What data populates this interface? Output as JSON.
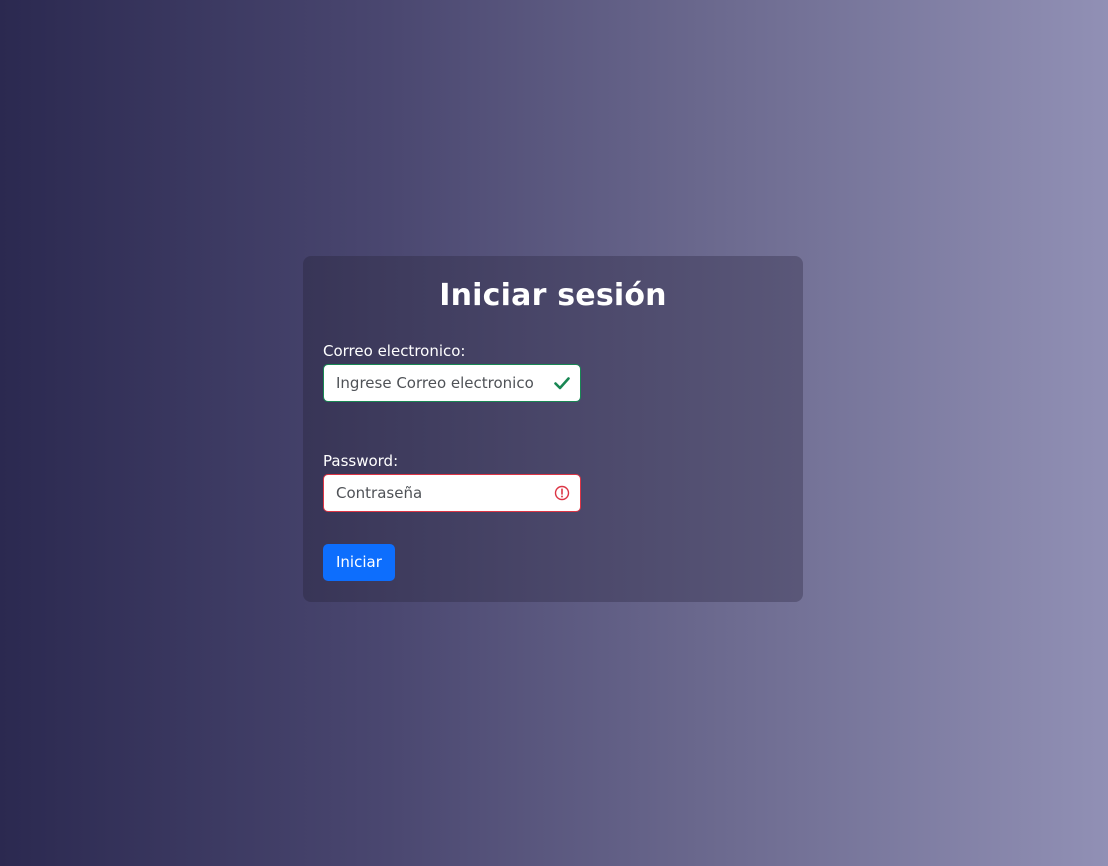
{
  "form": {
    "title": "Iniciar sesión",
    "email": {
      "label": "Correo electronico:",
      "placeholder": "Ingrese Correo electronico",
      "value": "",
      "state": "valid",
      "state_icon": "check-icon",
      "border_color": "#198754"
    },
    "password": {
      "label": "Password:",
      "placeholder": "Contraseña",
      "value": "",
      "state": "invalid",
      "state_icon": "exclamation-circle-icon",
      "border_color": "#dc3545"
    },
    "submit_label": "Iniciar"
  },
  "colors": {
    "accent": "#0d6efd",
    "valid": "#198754",
    "invalid": "#dc3545",
    "text_on_dark": "#ffffff"
  }
}
